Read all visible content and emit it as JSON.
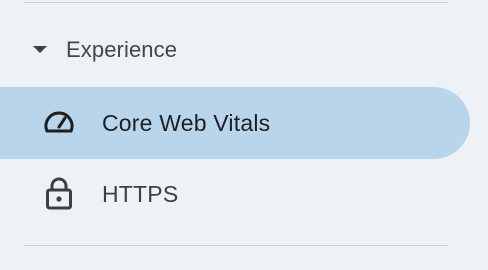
{
  "section": {
    "label": "Experience",
    "expanded": true,
    "caret_icon": "caret-down-icon"
  },
  "nav": {
    "items": [
      {
        "label": "Core Web Vitals",
        "icon": "speedometer-icon",
        "active": true
      },
      {
        "label": "HTTPS",
        "icon": "lock-icon",
        "active": false
      }
    ]
  },
  "colors": {
    "background": "#eef2f7",
    "active_highlight": "#b8d5ec",
    "divider": "#cfd3d8",
    "text": "#3c4043"
  }
}
